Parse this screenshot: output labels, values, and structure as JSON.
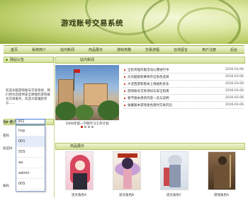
{
  "header": {
    "title": "游戏账号交易系统"
  },
  "nav": [
    "首页",
    "系统简介",
    "站内新闻",
    "商品展示",
    "游戏攻略",
    "交易流程",
    "在线留言",
    "用户注册",
    "后台"
  ],
  "left": {
    "notice_head": "网站公告",
    "notice_text": "欢迎光临游戏账号交易系统，我们将为您提供安全便捷的游戏账号交易服务，欢迎大家踊跃参与……",
    "login_head": "用户登录",
    "labels": [
      "用户名",
      "密码",
      "验证码"
    ],
    "user_value": "001",
    "dropdown_options": [
      "hsg",
      "001",
      "555",
      "aa",
      "admin",
      "005"
    ],
    "bottom_label": "按码"
  },
  "hot_head": "站内新闻",
  "photo_caption": "2008年第一学期学习工作计划",
  "news": [
    {
      "title": "全民英雄开服活动火爆进行中",
      "date": "2016-03-06"
    },
    {
      "title": "天天酷跑新赛季开启角色选择",
      "date": "2016-03-06"
    },
    {
      "title": "大话西游新版本上线福利多多",
      "date": "2016-03-06"
    },
    {
      "title": "游戏账号交易须知与安全指南",
      "date": "2016-03-06"
    },
    {
      "title": "春节版本更新内容一览与说明",
      "date": "2016-03-06"
    },
    {
      "title": "收藏版本游戏角色限时交易开启",
      "date": "2016-03-06"
    }
  ],
  "products_head": "商品展示",
  "products": [
    "逆天角色A",
    "逆天角色B",
    "逆天角色C",
    "游戏角色A"
  ]
}
